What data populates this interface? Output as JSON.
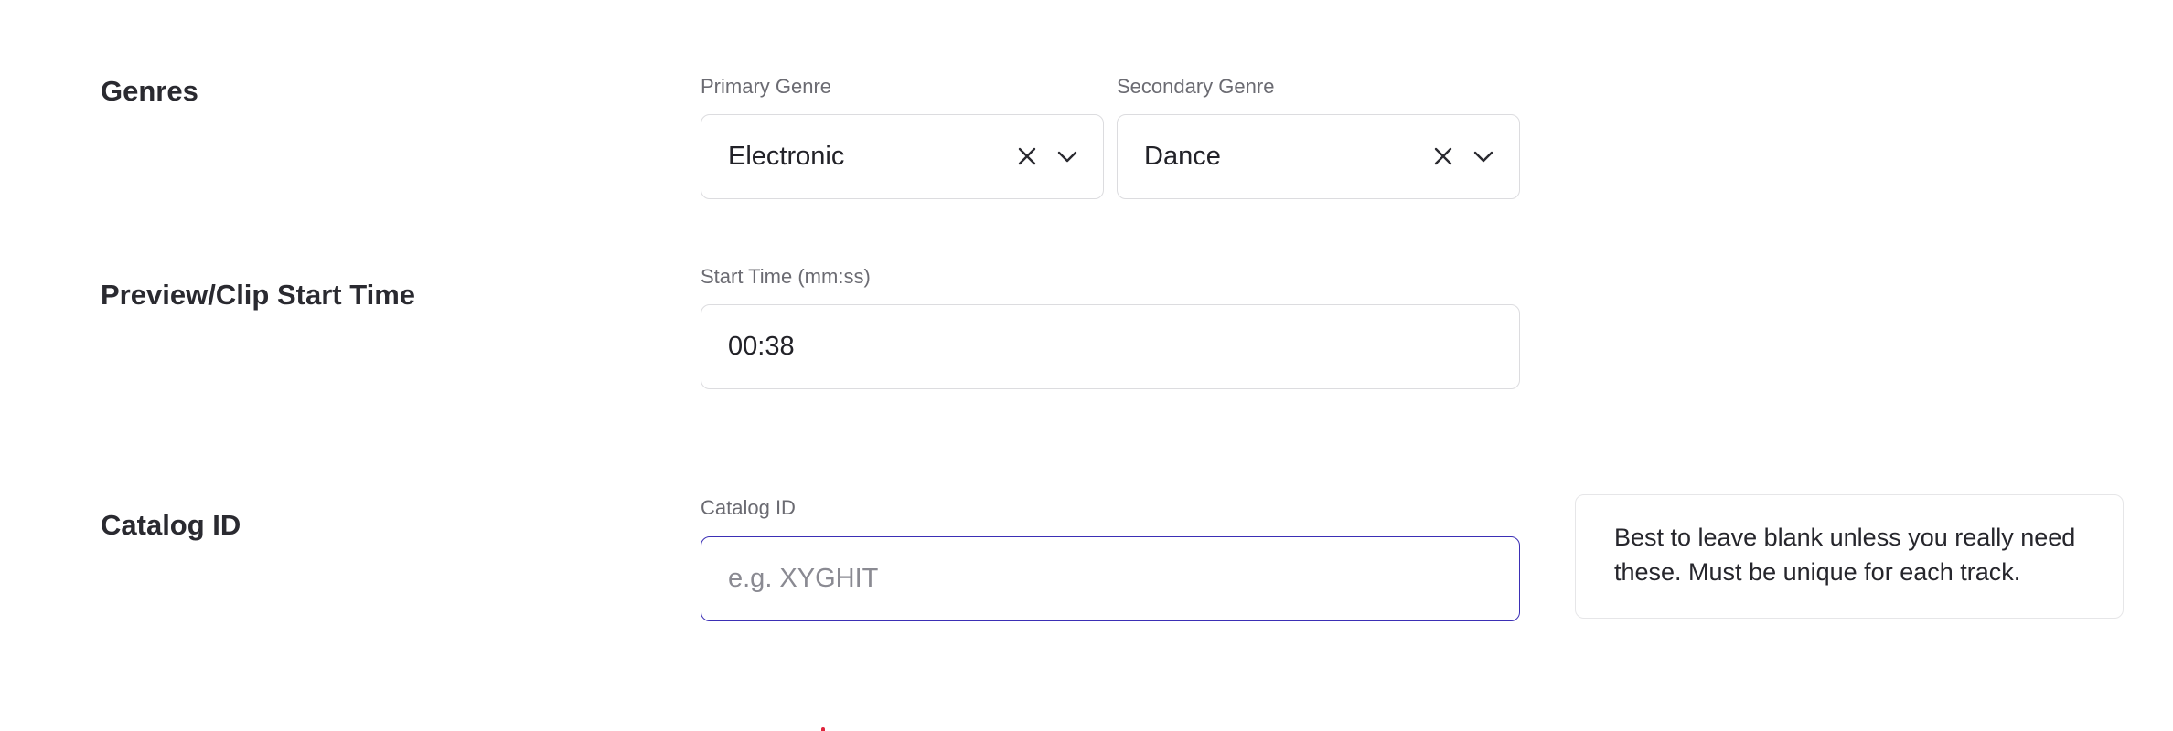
{
  "genres": {
    "section_title": "Genres",
    "primary": {
      "label": "Primary Genre",
      "value": "Electronic"
    },
    "secondary": {
      "label": "Secondary Genre",
      "value": "Dance"
    }
  },
  "preview": {
    "section_title": "Preview/Clip Start Time",
    "start_time": {
      "label": "Start Time (mm:ss)",
      "value": "00:38"
    }
  },
  "catalog": {
    "section_title": "Catalog ID",
    "field": {
      "label": "Catalog ID",
      "value": "",
      "placeholder": "e.g. XYGHIT"
    },
    "hint": "Best to leave blank unless you really need these. Must be unique for each track."
  },
  "icons": {
    "clear": "close-icon",
    "dropdown": "chevron-down-icon"
  },
  "colors": {
    "focus_border": "#3b2fb5",
    "border": "#dcdcdf",
    "label": "#6b6b72",
    "required_mark": "#e0243c"
  }
}
